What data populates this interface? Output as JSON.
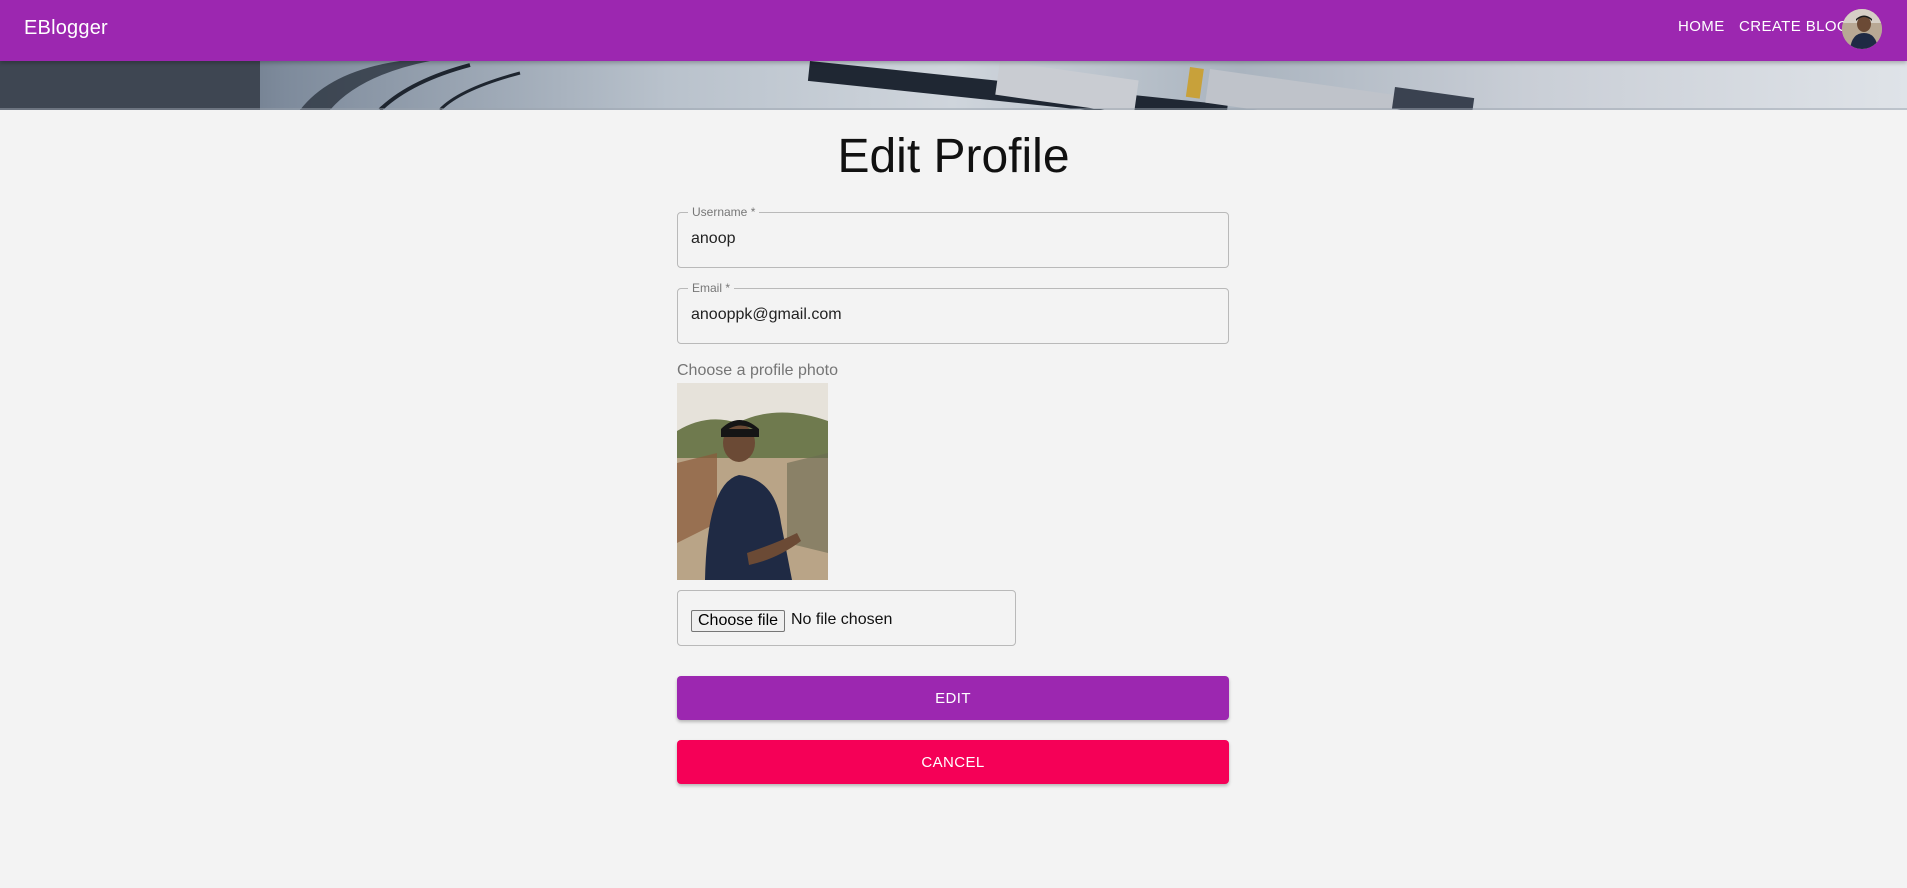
{
  "app": {
    "brand": "EBlogger",
    "nav": {
      "home": "HOME",
      "create_blog": "CREATE BLOG"
    },
    "colors": {
      "primary": "#9c27b0",
      "secondary": "#f50057",
      "background": "#f3f3f3"
    }
  },
  "page": {
    "title": "Edit Profile",
    "username": {
      "label": "Username *",
      "value": "anoop"
    },
    "email": {
      "label": "Email *",
      "value": "anooppk@gmail.com"
    },
    "photo": {
      "label": "Choose a profile photo"
    },
    "file_input": {
      "button": "Choose file",
      "status": "No file chosen"
    },
    "edit_button": "EDIT",
    "cancel_button": "CANCEL"
  }
}
